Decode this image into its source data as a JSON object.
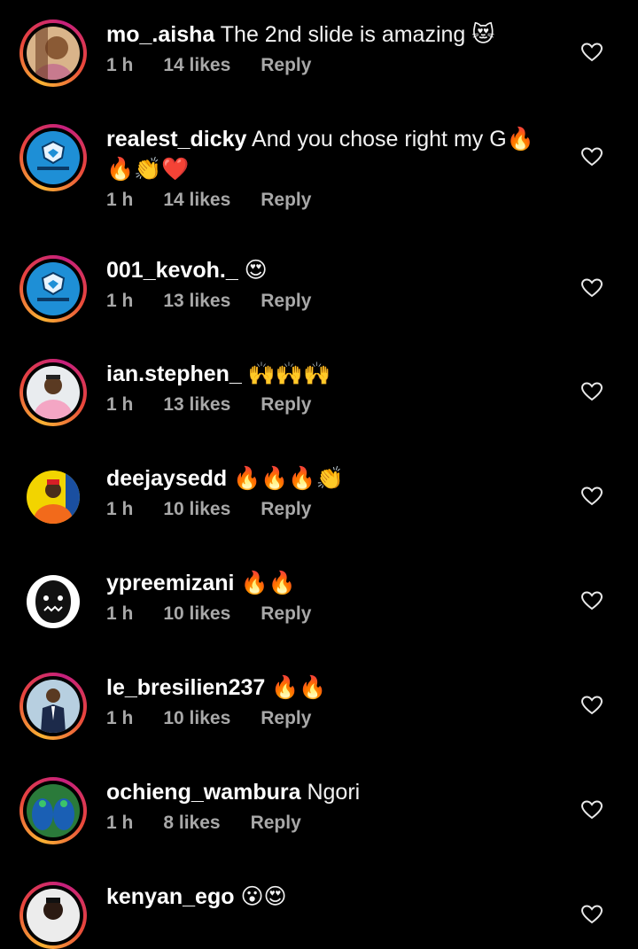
{
  "comments": [
    {
      "username": "mo_.aisha",
      "text": "The 2nd slide is amazing 😻",
      "time": "1 h",
      "likes": "14 likes",
      "reply": "Reply",
      "avatar_icon": "woman-portrait",
      "ring": true
    },
    {
      "username": "realest_dicky",
      "text": "And you chose right my G🔥",
      "text2": "🔥👏❤️",
      "time": "1 h",
      "likes": "14 likes",
      "reply": "Reply",
      "avatar_icon": "uniform-gang-logo",
      "ring": true
    },
    {
      "username": "001_kevoh._",
      "text": "😍",
      "time": "1 h",
      "likes": "13 likes",
      "reply": "Reply",
      "avatar_icon": "uniform-gang-logo",
      "ring": true
    },
    {
      "username": "ian.stephen_",
      "text": "🙌🙌🙌",
      "time": "1 h",
      "likes": "13 likes",
      "reply": "Reply",
      "avatar_icon": "man-pink-hoodie",
      "ring": true
    },
    {
      "username": "deejaysedd",
      "text": "🔥🔥🔥👏",
      "time": "1 h",
      "likes": "10 likes",
      "reply": "Reply",
      "avatar_icon": "man-orange-shirt",
      "ring": false
    },
    {
      "username": "ypreemizani",
      "text": "🔥🔥",
      "time": "1 h",
      "likes": "10 likes",
      "reply": "Reply",
      "avatar_icon": "gorilla-logo",
      "ring": false
    },
    {
      "username": "le_bresilien237",
      "text": "🔥🔥",
      "time": "1 h",
      "likes": "10 likes",
      "reply": "Reply",
      "avatar_icon": "man-suit",
      "ring": true
    },
    {
      "username": "ochieng_wambura",
      "text": "Ngori",
      "time": "1 h",
      "likes": "8 likes",
      "reply": "Reply",
      "avatar_icon": "peacock-art",
      "ring": true
    },
    {
      "username": "kenyan_ego",
      "text": "😮😍",
      "time": "",
      "likes": "",
      "reply": "",
      "avatar_icon": "man-portrait",
      "ring": true
    }
  ],
  "colors": {
    "background": "#000000",
    "meta": "#a8a8a8",
    "ring_start": "#f9b233",
    "ring_end": "#c51f7e"
  }
}
